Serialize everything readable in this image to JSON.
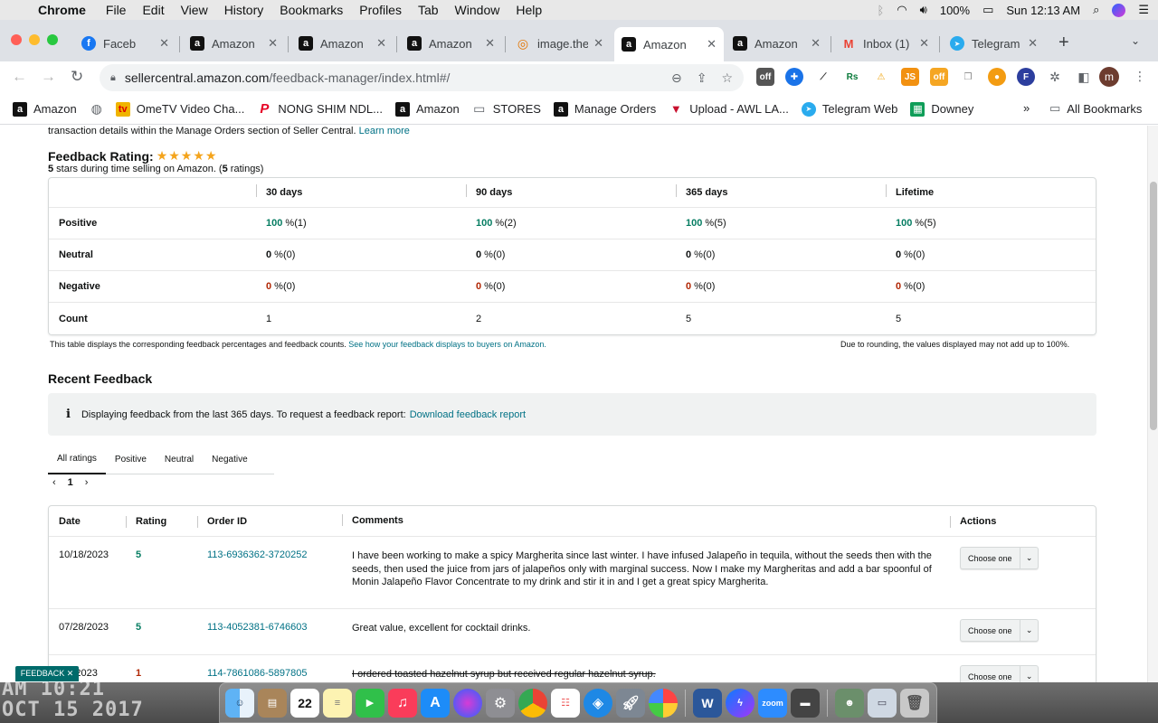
{
  "menubar": {
    "app": "Chrome",
    "items": [
      "File",
      "Edit",
      "View",
      "History",
      "Bookmarks",
      "Profiles",
      "Tab",
      "Window",
      "Help"
    ],
    "battery": "100%",
    "clock": "Sun 12:13 AM"
  },
  "tabs": [
    {
      "label": "Faceb",
      "icon": "facebook-icon",
      "color": "#1877f2",
      "glyph": "f"
    },
    {
      "label": "Amazon",
      "icon": "amazon-icon",
      "color": "#111111",
      "glyph": "a"
    },
    {
      "label": "Amazon",
      "icon": "amazon-icon",
      "color": "#111111",
      "glyph": "a"
    },
    {
      "label": "Amazon",
      "icon": "amazon-icon",
      "color": "#111111",
      "glyph": "a"
    },
    {
      "label": "image.the",
      "icon": "image-icon",
      "color": "#e37400",
      "glyph": "◎"
    },
    {
      "label": "Amazon",
      "icon": "amazon-icon",
      "color": "#111111",
      "glyph": "a"
    },
    {
      "label": "Amazon",
      "icon": "amazon-icon",
      "color": "#111111",
      "glyph": "a"
    },
    {
      "label": "Inbox (1)",
      "icon": "gmail-icon",
      "color": "#ea4335",
      "glyph": "M"
    },
    {
      "label": "Telegram",
      "icon": "telegram-icon",
      "color": "#2aabee",
      "glyph": "➤"
    }
  ],
  "url": {
    "host": "sellercentral.amazon.com",
    "path": "/feedback-manager/index.html#/"
  },
  "bookmarks": [
    {
      "label": "Amazon",
      "icon": "amazon-icon"
    },
    {
      "label": "",
      "icon": "globe-icon"
    },
    {
      "label": "OmeTV Video Cha...",
      "icon": "ometv-icon"
    },
    {
      "label": "NONG SHIM NDL...",
      "icon": "pinterest-icon"
    },
    {
      "label": "Amazon",
      "icon": "amazon-icon"
    },
    {
      "label": "STORES",
      "icon": "folder-icon"
    },
    {
      "label": "Manage Orders",
      "icon": "amazon-icon"
    },
    {
      "label": "Upload - AWL LA...",
      "icon": "awl-icon"
    },
    {
      "label": "Telegram Web",
      "icon": "telegram-icon"
    },
    {
      "label": "Downey",
      "icon": "sheets-icon"
    }
  ],
  "bookmarks_more": "»",
  "bookmarks_all": "All Bookmarks",
  "page": {
    "intro": "transaction details within the Manage Orders section of Seller Central.",
    "learn_more": "Learn more",
    "rating_title": "Feedback Rating:",
    "stars": "★★★★★",
    "rating_sub_stars": "5",
    "rating_sub_text": " stars during time selling on Amazon. (",
    "rating_sub_count": "5",
    "rating_sub_end": " ratings)",
    "summary": {
      "periods": [
        "30 days",
        "90 days",
        "365 days",
        "Lifetime"
      ],
      "rows": [
        {
          "label": "Positive",
          "type": "pos",
          "values": [
            {
              "pct": "100",
              "count": "(1)"
            },
            {
              "pct": "100",
              "count": "(2)"
            },
            {
              "pct": "100",
              "count": "(5)"
            },
            {
              "pct": "100",
              "count": "(5)"
            }
          ]
        },
        {
          "label": "Neutral",
          "type": "neu",
          "values": [
            {
              "pct": "0",
              "count": "(0)"
            },
            {
              "pct": "0",
              "count": "(0)"
            },
            {
              "pct": "0",
              "count": "(0)"
            },
            {
              "pct": "0",
              "count": "(0)"
            }
          ]
        },
        {
          "label": "Negative",
          "type": "neg",
          "values": [
            {
              "pct": "0",
              "count": "(0)"
            },
            {
              "pct": "0",
              "count": "(0)"
            },
            {
              "pct": "0",
              "count": "(0)"
            },
            {
              "pct": "0",
              "count": "(0)"
            }
          ]
        }
      ],
      "count_label": "Count",
      "counts": [
        "1",
        "2",
        "5",
        "5"
      ]
    },
    "table_note": "This table displays the corresponding feedback percentages and feedback counts.",
    "table_note_link": "See how your feedback displays to buyers on Amazon.",
    "rounding_note": "Due to rounding, the values displayed may not add up to 100%.",
    "recent_title": "Recent Feedback",
    "info_text": "Displaying feedback from the last 365 days. To request a feedback report:",
    "info_link": "Download feedback report",
    "filter_tabs": [
      "All ratings",
      "Positive",
      "Neutral",
      "Negative"
    ],
    "page_number": "1",
    "columns": [
      "Date",
      "Rating",
      "Order ID",
      "Comments",
      "Actions"
    ],
    "feedback": [
      {
        "date": "10/18/2023",
        "rating": "5",
        "order": "113-6936362-3720252",
        "comment": "I have been working to make a spicy Margherita since last winter. I have infused Jalapeño in tequila, without the seeds then with the seeds, then used the juice from jars of jalapeños only with marginal success. Now I make my Margheritas and add a bar spoonful of Monin Jalapeño Flavor Concentrate to my drink and stir it in and I get a great spicy Margherita.",
        "action": "Choose one"
      },
      {
        "date": "07/28/2023",
        "rating": "5",
        "order": "113-4052381-6746603",
        "comment": "Great value, excellent for cocktail drinks.",
        "action": "Choose one"
      },
      {
        "date": "...9/2023",
        "rating": "1",
        "order": "114-7861086-5897805",
        "comment": "I ordered toasted hazelnut syrup but received regular hazelnut syrup.",
        "action": "Choose one"
      }
    ],
    "feedback_button": "FEEDBACK ✕"
  },
  "desktop": {
    "line1": "AM 10:21",
    "line2": "OCT 15 2017"
  },
  "colors": {
    "positive": "#067d62",
    "negative": "#b12704",
    "link": "#007185",
    "star": "#f4a41c"
  }
}
